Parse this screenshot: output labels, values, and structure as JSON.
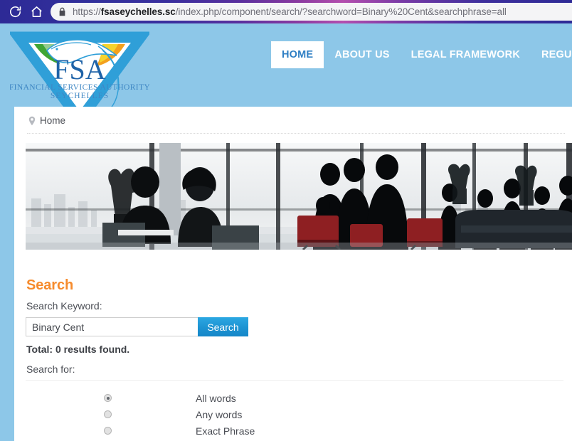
{
  "browser": {
    "reload_icon": "reload-icon",
    "home_icon": "home-icon",
    "lock_icon": "lock-icon",
    "url_full": "https://fsaseychelles.sc/index.php/component/search/?searchword=Binary%20Cent&searchphrase=all",
    "url_scheme": "https://",
    "url_domain": "fsaseychelles.sc",
    "url_path": "/index.php/component/search/?searchword=Binary%20Cent&searchphrase=all"
  },
  "header": {
    "logo": {
      "name": "fsa-logo",
      "acronym": "FSA",
      "line1": "FINANCIAL SERVICES AUTHORITY",
      "line2": "SEYCHELLES",
      "colors": {
        "diamond": "#2f9fd8",
        "green": "#3fa535",
        "orange": "#f3a11d",
        "yellow": "#f6d32d",
        "text": "#1f63a8"
      }
    },
    "nav": [
      {
        "label": "HOME",
        "active": true
      },
      {
        "label": "ABOUT US",
        "active": false
      },
      {
        "label": "LEGAL FRAMEWORK",
        "active": false
      },
      {
        "label": "REGULATED ENTITIE",
        "active": false
      }
    ],
    "bg_color": "#8dc7e8"
  },
  "breadcrumb": {
    "pin_icon": "location-pin-icon",
    "label": "Home"
  },
  "banner": {
    "name": "office-meeting-banner",
    "alt": "Black and white silhouettes of business people in an office lobby"
  },
  "search": {
    "title": "Search",
    "keyword_label": "Search Keyword:",
    "input_value": "Binary Cent",
    "input_placeholder": "",
    "button_label": "Search",
    "total_text": "Total: 0 results found.",
    "search_for_label": "Search for:",
    "accent_color": "#f68b2c",
    "button_color": "#1d93d2",
    "options": [
      {
        "label": "All words",
        "checked": true
      },
      {
        "label": "Any words",
        "checked": false
      },
      {
        "label": "Exact Phrase",
        "checked": false
      }
    ]
  }
}
